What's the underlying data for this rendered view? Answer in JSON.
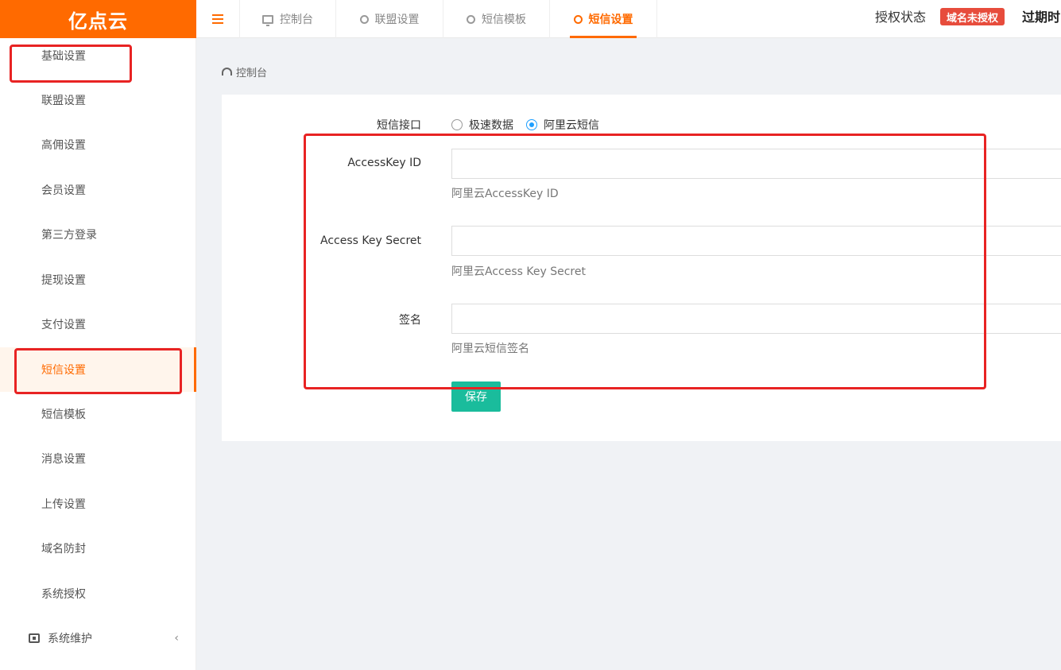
{
  "app": {
    "logo": "亿点云"
  },
  "sidebar": {
    "items": [
      {
        "label": "基础设置"
      },
      {
        "label": "联盟设置"
      },
      {
        "label": "高佣设置"
      },
      {
        "label": "会员设置"
      },
      {
        "label": "第三方登录"
      },
      {
        "label": "提现设置"
      },
      {
        "label": "支付设置"
      },
      {
        "label": "短信设置",
        "active": true
      },
      {
        "label": "短信模板"
      },
      {
        "label": "消息设置"
      },
      {
        "label": "上传设置"
      },
      {
        "label": "域名防封"
      },
      {
        "label": "系统授权"
      }
    ],
    "group": {
      "label": "系统维护",
      "chevron": "‹"
    }
  },
  "topbar": {
    "tabs": [
      {
        "label": "控制台",
        "icon": "monitor-icon"
      },
      {
        "label": "联盟设置",
        "icon": "ring-icon"
      },
      {
        "label": "短信模板",
        "icon": "ring-icon"
      },
      {
        "label": "短信设置",
        "icon": "ring-icon",
        "active": true
      }
    ],
    "auth_label": "授权状态",
    "auth_badge": "域名未授权",
    "expire_label": "过期时"
  },
  "breadcrumb": {
    "label": "控制台"
  },
  "form": {
    "interface": {
      "label": "短信接口",
      "options": [
        {
          "label": "极速数据",
          "checked": false
        },
        {
          "label": "阿里云短信",
          "checked": true
        }
      ]
    },
    "fields": [
      {
        "label": "AccessKey ID",
        "value": "",
        "help": "阿里云AccessKey ID"
      },
      {
        "label": "Access Key Secret",
        "value": "",
        "help": "阿里云Access Key Secret"
      },
      {
        "label": "签名",
        "value": "",
        "help": "阿里云短信签名"
      }
    ],
    "save_label": "保存"
  },
  "colors": {
    "brand": "#ff6a00",
    "badge": "#e74c3c",
    "save": "#1abc9c",
    "radio": "#1e9fff",
    "annotation": "#e82323"
  }
}
